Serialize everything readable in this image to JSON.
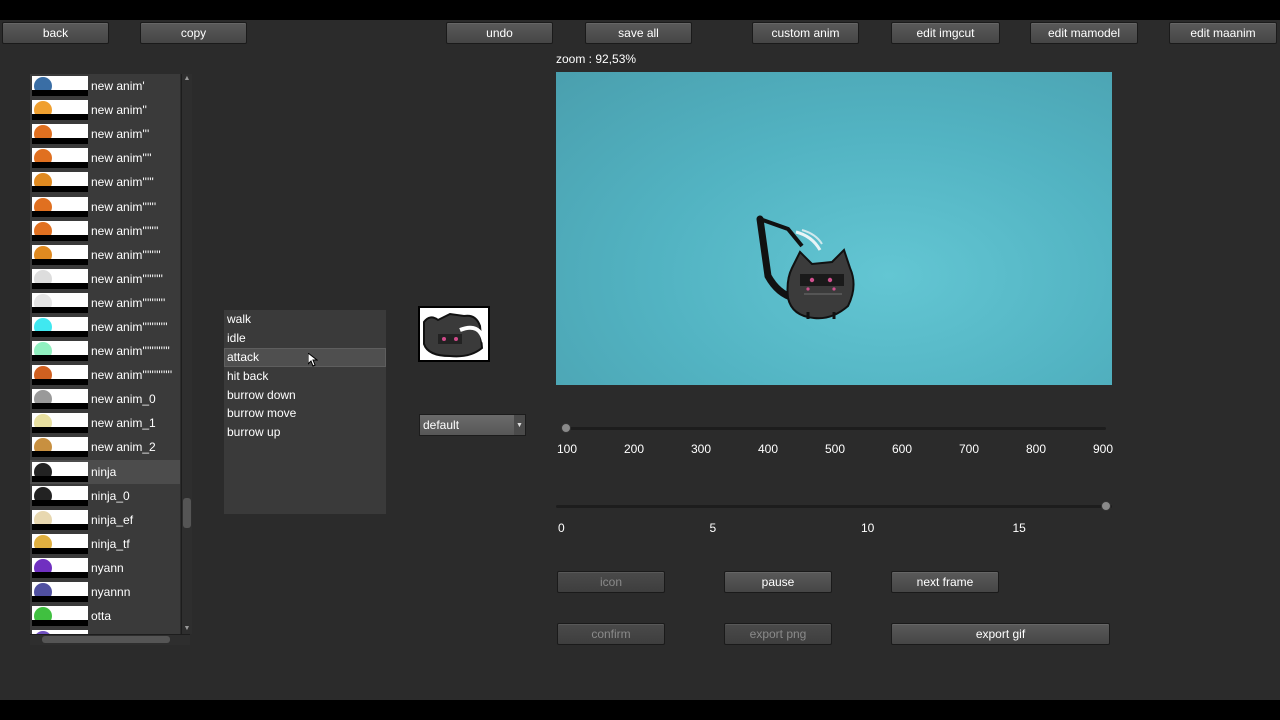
{
  "toolbar": {
    "back": "back",
    "copy": "copy",
    "undo": "undo",
    "save_all": "save all",
    "custom_anim": "custom anim",
    "edit_imgcut": "edit imgcut",
    "edit_mamodel": "edit mamodel",
    "edit_maanim": "edit maanim"
  },
  "anim_list": {
    "selected_index": 16,
    "items": [
      {
        "label": "new anim'",
        "color": "#3a6ea5"
      },
      {
        "label": "new anim''",
        "color": "#f0a030"
      },
      {
        "label": "new anim'''",
        "color": "#e07020"
      },
      {
        "label": "new anim''''",
        "color": "#e07020"
      },
      {
        "label": "new anim'''''",
        "color": "#e08a20"
      },
      {
        "label": "new anim''''''",
        "color": "#e07020"
      },
      {
        "label": "new anim'''''''",
        "color": "#e07020"
      },
      {
        "label": "new anim''''''''",
        "color": "#e08a20"
      },
      {
        "label": "new anim'''''''''",
        "color": "#dddddd"
      },
      {
        "label": "new anim''''''''''",
        "color": "#e6e6e6"
      },
      {
        "label": "new anim'''''''''''",
        "color": "#40e8f0"
      },
      {
        "label": "new anim''''''''''''",
        "color": "#90f0c0"
      },
      {
        "label": "new anim'''''''''''''",
        "color": "#d06020"
      },
      {
        "label": "new anim_0",
        "color": "#999999"
      },
      {
        "label": "new anim_1",
        "color": "#e8e0a0"
      },
      {
        "label": "new anim_2",
        "color": "#c89040"
      },
      {
        "label": "ninja",
        "color": "#222222"
      },
      {
        "label": "ninja_0",
        "color": "#222222"
      },
      {
        "label": "ninja_ef",
        "color": "#e8d8b0"
      },
      {
        "label": "ninja_tf",
        "color": "#e0b040"
      },
      {
        "label": "nyann",
        "color": "#7030c0"
      },
      {
        "label": "nyannn",
        "color": "#5050a0"
      },
      {
        "label": "otta",
        "color": "#40c040"
      },
      {
        "label": "",
        "color": "#7050c0"
      }
    ]
  },
  "type_list": {
    "selected_index": 2,
    "items": [
      "walk",
      "idle",
      "attack",
      "hit back",
      "burrow down",
      "burrow move",
      "burrow up"
    ]
  },
  "select": {
    "value": "default"
  },
  "zoom": {
    "label": "zoom : 92,53%"
  },
  "preview_bg": "#5ab8c6",
  "speed_slider": {
    "ticks": [
      "100",
      "200",
      "300",
      "400",
      "500",
      "600",
      "700",
      "800",
      "900"
    ],
    "value": 100
  },
  "frame_slider": {
    "ticks": [
      "0",
      "5",
      "10",
      "15"
    ],
    "value": 18,
    "max": 18
  },
  "controls": {
    "icon": "icon",
    "pause": "pause",
    "next_frame": "next frame",
    "confirm": "confirm",
    "export_png": "export png",
    "export_gif": "export gif"
  }
}
